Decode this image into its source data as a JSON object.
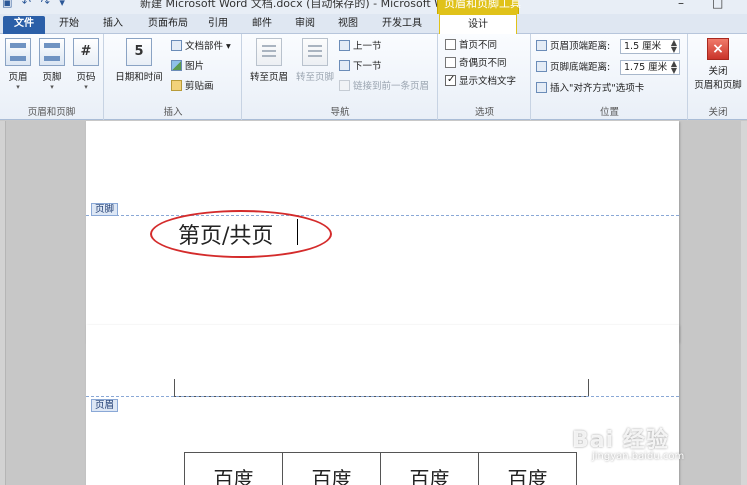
{
  "titlebar": {
    "quick_access": "▣ ↶ ↷ ▾",
    "title": "新建 Microsoft Word 文档.docx (自动保存的) - Microsoft Word",
    "context_group": "页眉和页脚工具",
    "minimize": "–",
    "maximize": "□"
  },
  "tabs": {
    "file": "文件",
    "items": [
      "开始",
      "插入",
      "页面布局",
      "引用",
      "邮件",
      "审阅",
      "视图",
      "开发工具"
    ],
    "active": "设计"
  },
  "ribbon": {
    "group_header_footer": {
      "label": "页眉和页脚",
      "header": "页眉",
      "footer": "页脚",
      "page_number": "页码"
    },
    "group_insert": {
      "label": "插入",
      "date_time": "日期和时间",
      "doc_parts": "文档部件",
      "picture": "图片",
      "clip_art": "剪贴画"
    },
    "group_nav": {
      "label": "导航",
      "goto_header": "转至页眉",
      "goto_footer": "转至页脚",
      "prev_section": "上一节",
      "next_section": "下一节",
      "link_prev": "链接到前一条页眉"
    },
    "group_options": {
      "label": "选项",
      "first_page_diff": "首页不同",
      "odd_even_diff": "奇偶页不同",
      "show_doc_text": "显示文档文字"
    },
    "group_position": {
      "label": "位置",
      "header_top_label": "页眉顶端距离:",
      "header_top_value": "1.5 厘米",
      "footer_bottom_label": "页脚底端距离:",
      "footer_bottom_value": "1.75 厘米",
      "insert_align_tab": "插入\"对齐方式\"选项卡"
    },
    "group_close": {
      "label": "关闭",
      "close_btn": "关闭\n页眉和页脚"
    }
  },
  "document": {
    "footer_tag": "页脚",
    "footer_text": "第页/共页",
    "header_tag": "页眉",
    "table_cells": [
      "百度",
      "百度",
      "百度",
      "百度"
    ]
  },
  "watermark": {
    "main": "Bai 经验",
    "sub": "jingyan.baidu.com"
  },
  "colors": {
    "accent_file": "#2b5fa8",
    "context_tab": "#e0c21a",
    "annotation_ellipse": "#d42b2b",
    "hf_dashed": "#8aa8d6"
  }
}
